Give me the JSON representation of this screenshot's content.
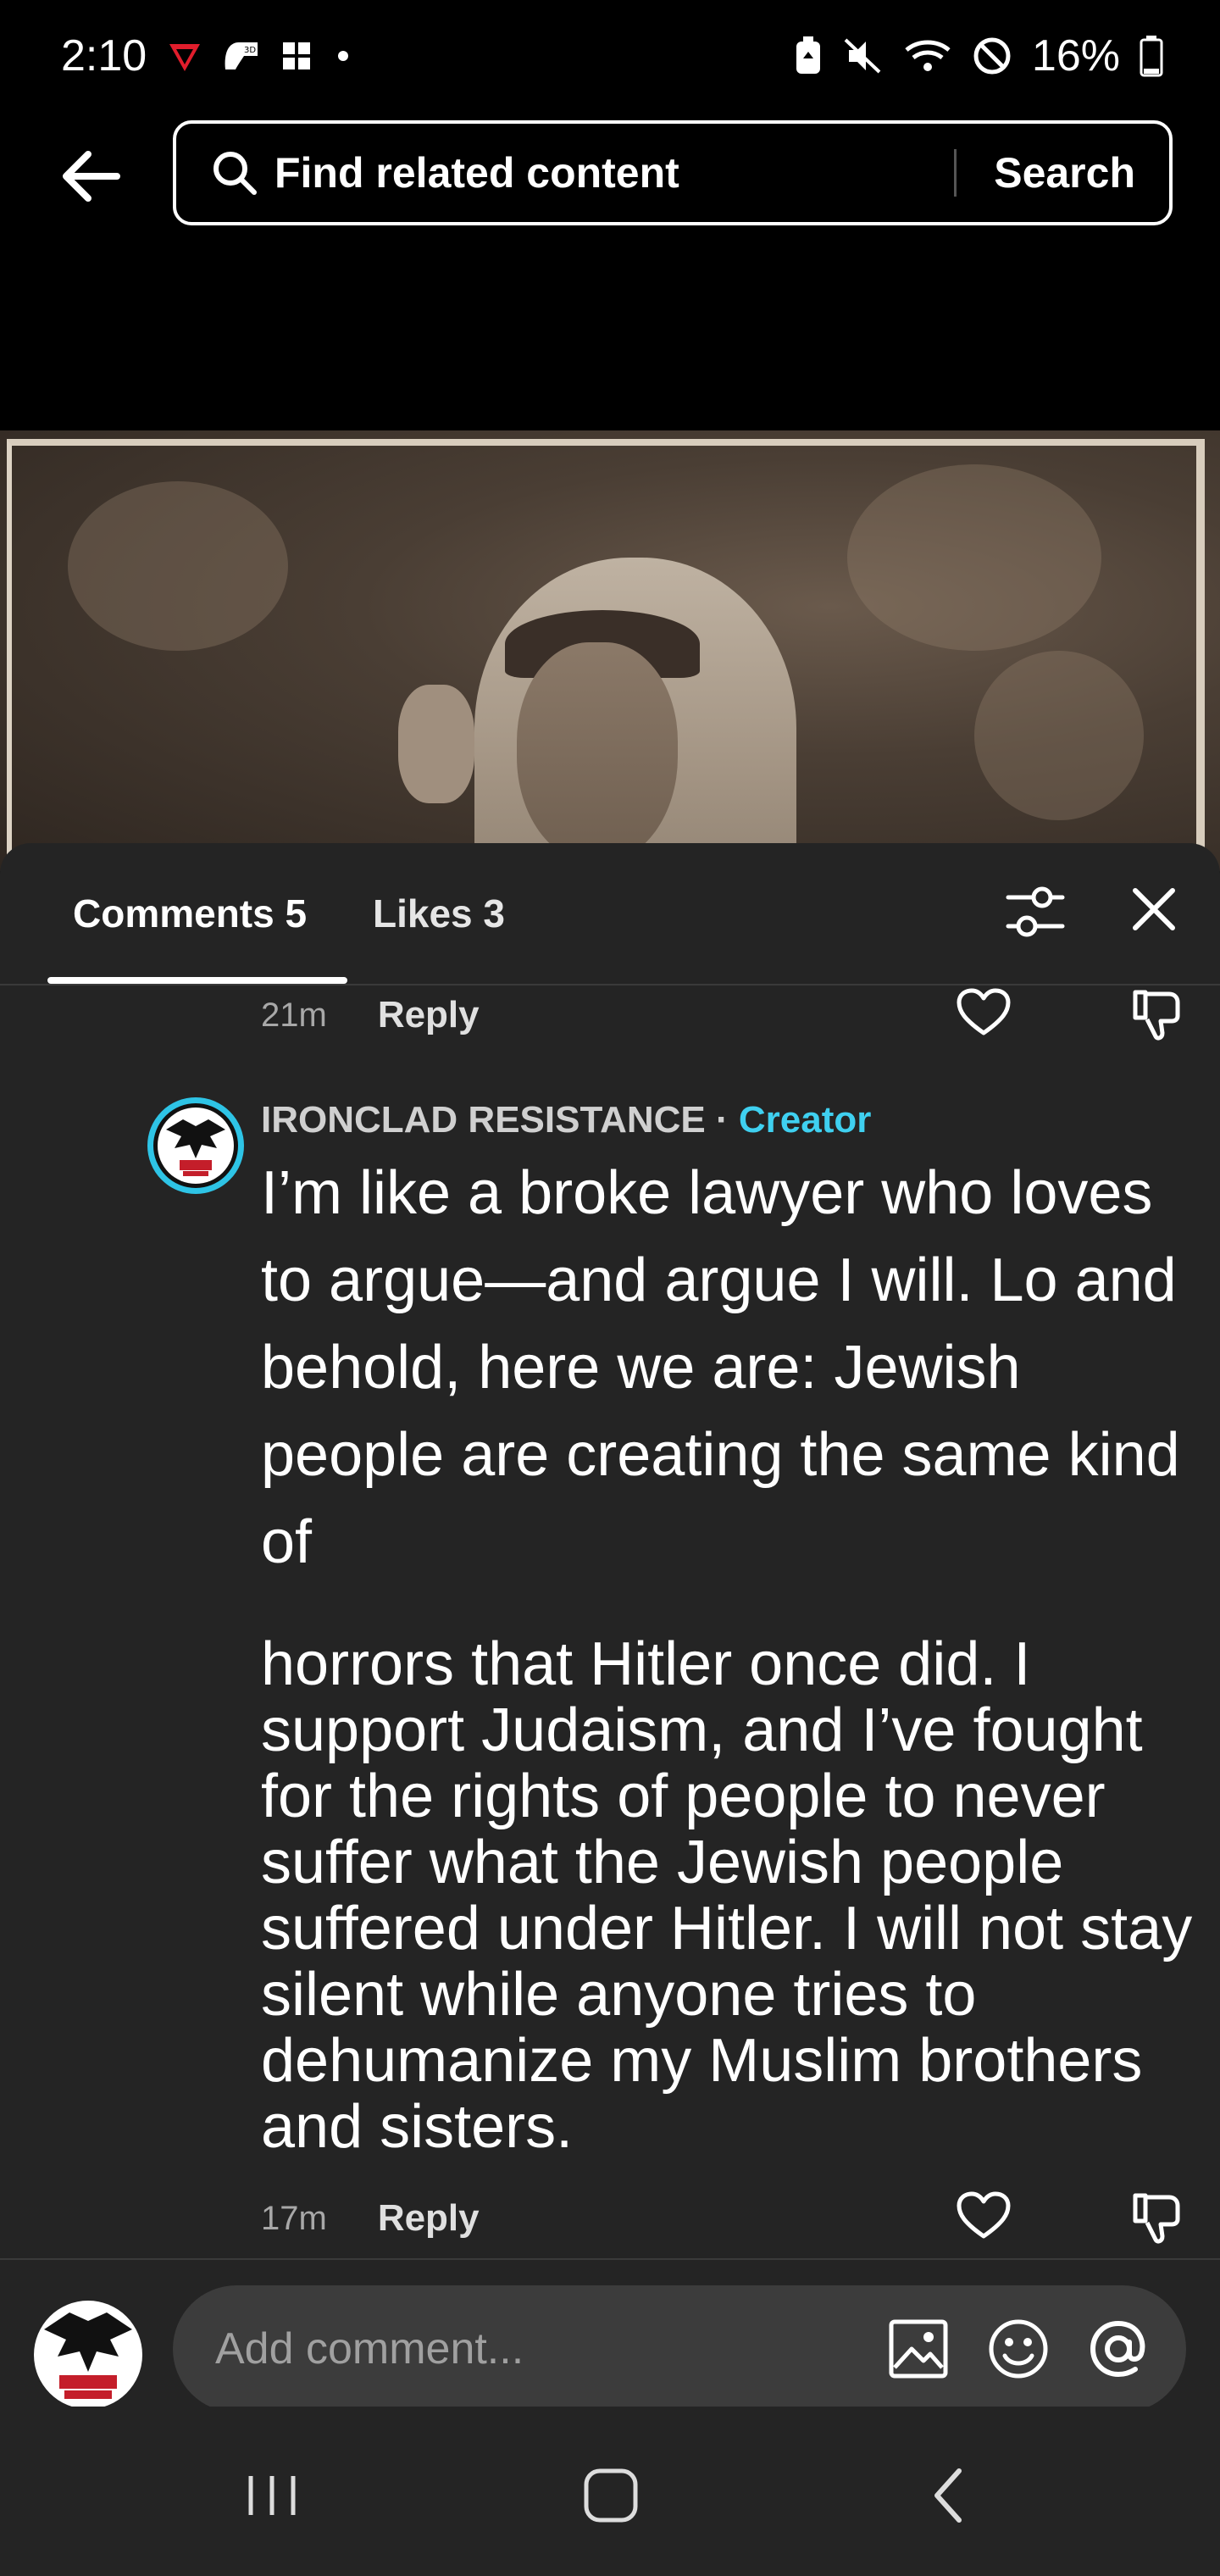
{
  "status_bar": {
    "time": "2:10",
    "battery": "16%",
    "icons": [
      "app-notification-icon",
      "gesture-icon",
      "app-icon",
      "dot-icon",
      "battery-saver-icon",
      "mute-icon",
      "wifi-icon",
      "do-not-disturb-icon",
      "battery-icon"
    ]
  },
  "header": {
    "search_placeholder": "Find related content",
    "search_button": "Search"
  },
  "sheet": {
    "tabs": [
      {
        "label": "Comments 5",
        "active": true
      },
      {
        "label": "Likes 3",
        "active": false
      }
    ],
    "previous_comment": {
      "time": "21m",
      "reply_label": "Reply"
    },
    "comment": {
      "author": "IRONCLAD RESISTANCE",
      "separator": " · ",
      "badge": "Creator",
      "text_part1": "I’m like a broke lawyer who loves to argue—and argue I will. Lo and behold, here we are: Jewish people are creating the same kind of",
      "text_part2": "horrors that Hitler once did. I support Judaism, and I’ve fought for the rights of people to never suffer what the Jewish people suffered under Hitler. I will not stay silent while anyone tries to dehumanize my Muslim brothers and sisters.",
      "time": "17m",
      "reply_label": "Reply"
    }
  },
  "input_bar": {
    "placeholder": "Add comment..."
  },
  "colors": {
    "accent": "#2ec4e6",
    "sheet_bg": "#242424",
    "input_bg": "#3c3c3c"
  }
}
